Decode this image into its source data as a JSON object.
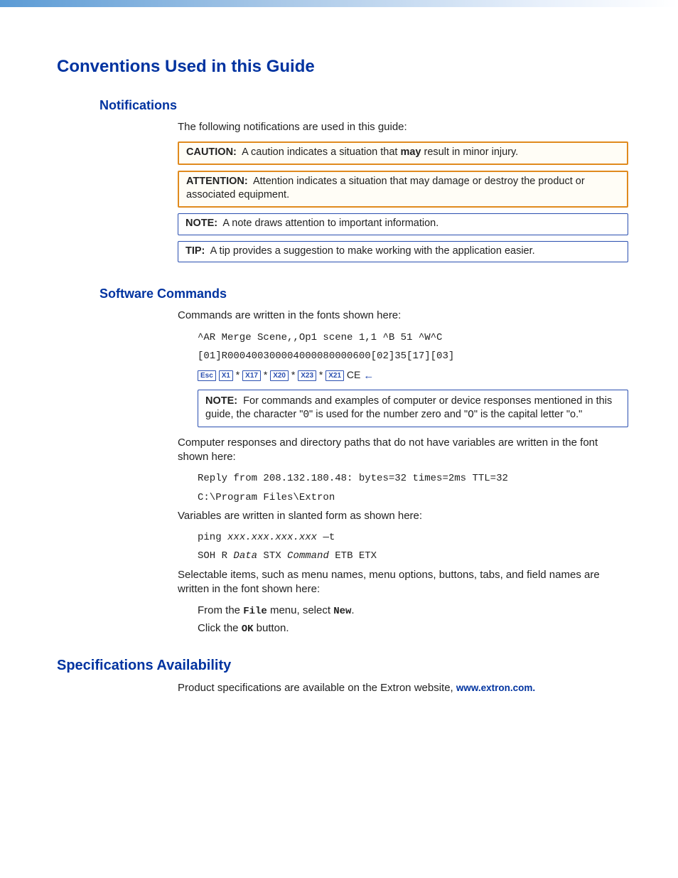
{
  "header": {
    "title": "Conventions Used in this Guide"
  },
  "notifications": {
    "heading": "Notifications",
    "intro": "The following notifications are used in this guide:",
    "caution_label": "CAUTION:",
    "caution_pre": "A caution indicates a situation that ",
    "caution_bold": "may",
    "caution_post": " result in minor injury.",
    "attention_label": "ATTENTION:",
    "attention_text": "Attention indicates a situation that may damage or destroy the product or associated equipment.",
    "note_label": "NOTE:",
    "note_text": "A note draws attention to important information.",
    "tip_label": "TIP:",
    "tip_text": "A tip provides a suggestion to make working with the application easier."
  },
  "software": {
    "heading": "Software Commands",
    "intro": "Commands are written in the fonts shown here:",
    "cmd1": "^AR Merge Scene,,Op1 scene 1,1 ^B 51 ^W^C",
    "cmd2": "[01]R000400300004000080000600[02]35[17][03]",
    "keys": {
      "esc": "Esc",
      "x1": "X1",
      "x17": "X17",
      "x20": "X20",
      "x23": "X23",
      "x21": "X21"
    },
    "ce": " CE ",
    "star": " * ",
    "note_label": "NOTE:",
    "note_text_1": "For commands and examples of computer or device responses mentioned in this guide, the character \"",
    "note_zero": "0",
    "note_text_2": "\" is used for the number zero and \"",
    "note_oh": "O",
    "note_text_3": "\" is the capital letter \"o.\"",
    "resp_intro": "Computer responses and directory paths that do not have variables are written in the font shown here:",
    "resp1": "Reply from 208.132.180.48: bytes=32 times=2ms TTL=32",
    "resp2": "C:\\Program Files\\Extron",
    "var_intro": "Variables are written in slanted form as shown here:",
    "var1_a": "ping ",
    "var1_b": "xxx.xxx.xxx.xxx",
    "var1_c": " —t",
    "var2_a": "SOH R ",
    "var2_b": "Data",
    "var2_c": " STX ",
    "var2_d": "Command",
    "var2_e": " ETB ETX",
    "sel_intro": "Selectable items, such as menu names, menu options, buttons, tabs, and field names are written in the font shown here:",
    "sel1_a": "From the ",
    "sel1_b": "File",
    "sel1_c": " menu, select ",
    "sel1_d": "New",
    "sel1_e": ".",
    "sel2_a": "Click the ",
    "sel2_b": "OK",
    "sel2_c": " button."
  },
  "specs": {
    "heading": "Specifications Availability",
    "text": "Product specifications are available on the Extron website, ",
    "link": "www.extron.com",
    "dot": "."
  }
}
